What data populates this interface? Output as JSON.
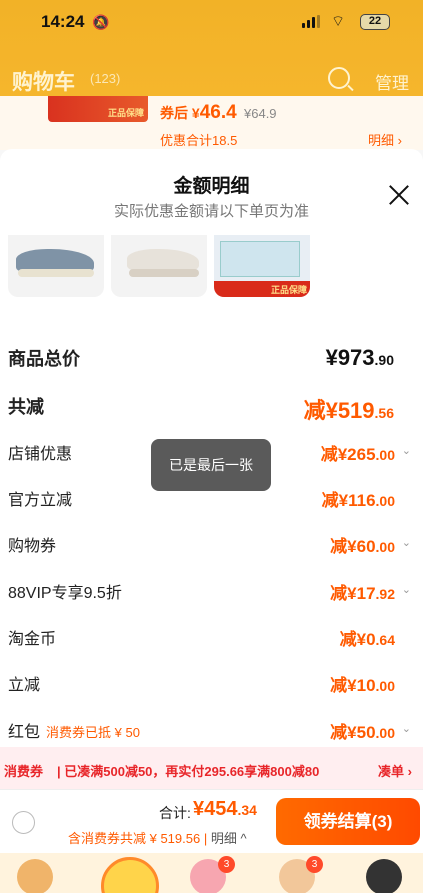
{
  "status_bar": {
    "time": "14:24",
    "battery": "22"
  },
  "nav": {
    "title": "购物车",
    "count": "(123)",
    "manage": "管理"
  },
  "peek_item": {
    "price_prefix": "券后",
    "price_currency": "¥",
    "price": "46.4",
    "original_price": "¥64.9",
    "discount_text": "优惠合计18.5",
    "detail_link": "明细 ›",
    "strip_text": "正品保障"
  },
  "sheet": {
    "title": "金额明细",
    "subtitle": "实际优惠金额请以下单页为准",
    "thumb_strip": "正品保障",
    "rows": [
      {
        "label": "商品总价",
        "value_main": "¥973",
        "value_dec": ".90"
      },
      {
        "label": "共减",
        "value_main": "减¥519",
        "value_dec": ".56"
      },
      {
        "label": "店铺优惠",
        "value_main": "减¥265",
        "value_dec": ".00"
      },
      {
        "label": "官方立减",
        "value_main": "减¥116",
        "value_dec": ".00"
      },
      {
        "label": "购物券",
        "value_main": "减¥60",
        "value_dec": ".00"
      },
      {
        "label": "88VIP专享9.5折",
        "value_main": "减¥17",
        "value_dec": ".92"
      },
      {
        "label": "淘金币",
        "value_main": "减¥0",
        "value_dec": ".64"
      },
      {
        "label": "立减",
        "value_main": "减¥10",
        "value_dec": ".00"
      },
      {
        "label": "红包",
        "tag": "消费券已抵 ¥ 50",
        "value_main": "减¥50",
        "value_dec": ".00"
      }
    ]
  },
  "toast": "已是最后一张",
  "banner": {
    "tag": "消费券",
    "text": "| 已凑满500减50，再实付295.66享满800减80",
    "action": "凑单 ›"
  },
  "footer": {
    "total_label": "合计:",
    "total_main": "¥454",
    "total_dec": ".34",
    "sub_text": "含消费券共减 ¥ 519.56 |",
    "sub_link": "明细 ^",
    "checkout": "领券结算(3)"
  },
  "tabbar": {
    "badges": [
      "3",
      "3"
    ]
  },
  "colors": {
    "accent": "#ff5a00",
    "header": "#f2b227",
    "banner_bg": "#ffeef0"
  }
}
